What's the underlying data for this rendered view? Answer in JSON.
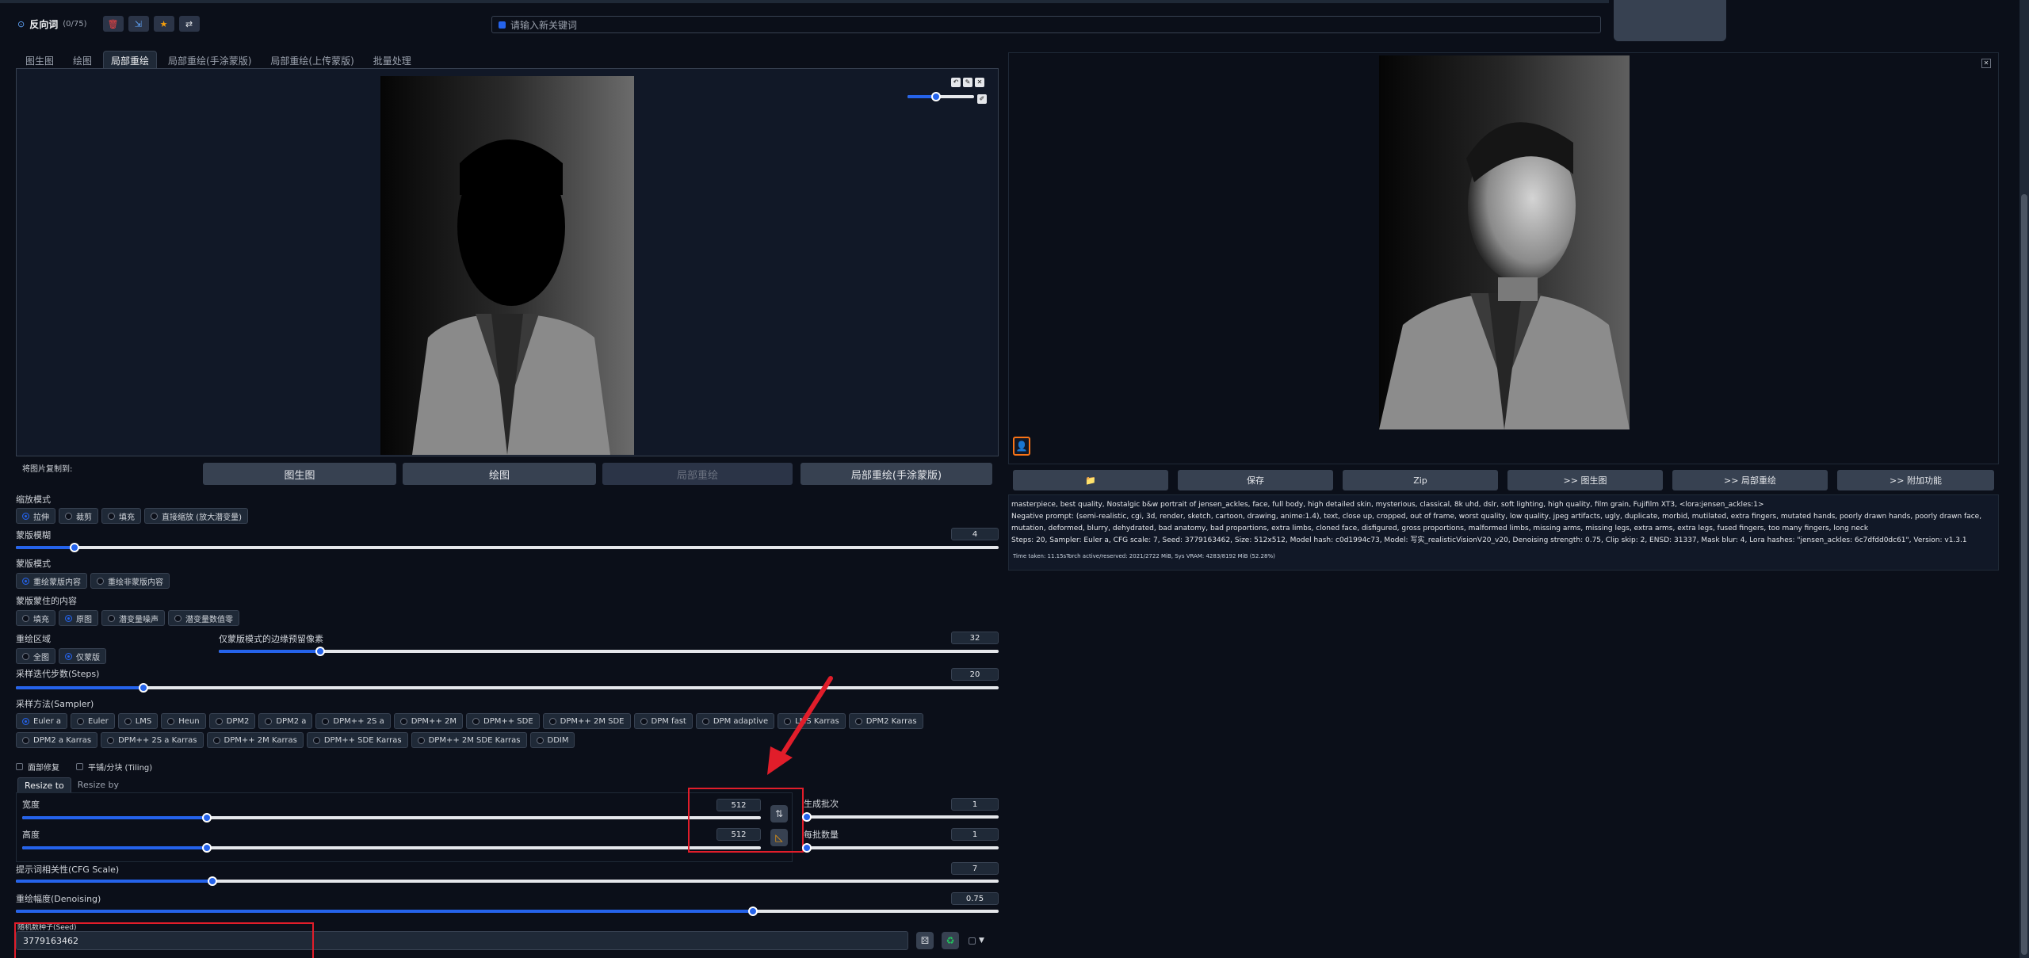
{
  "negative": {
    "title": "反向词",
    "count": "(0/75)",
    "placeholder": "请输入新关键词"
  },
  "tabs": [
    "图生图",
    "绘图",
    "局部重绘",
    "局部重绘(手涂蒙版)",
    "局部重绘(上传蒙版)",
    "批量处理"
  ],
  "canvas": {
    "copy_label": "将图片复制到:"
  },
  "copy_buttons": [
    "图生图",
    "绘图",
    "局部重绘",
    "局部重绘(手涂蒙版)"
  ],
  "resize_mode": {
    "label": "缩放模式",
    "options": [
      "拉伸",
      "裁剪",
      "填充",
      "直接缩放 (放大潜变量)"
    ]
  },
  "mask_blur": {
    "label": "蒙版模糊",
    "value": "4",
    "fraction": 0.06
  },
  "mask_mode": {
    "label": "蒙版模式",
    "options": [
      "重绘蒙版内容",
      "重绘非蒙版内容"
    ]
  },
  "masked_content": {
    "label": "蒙版蒙住的内容",
    "options": [
      "填充",
      "原图",
      "潜变量噪声",
      "潜变量数值零"
    ]
  },
  "inpaint_area": {
    "label": "重绘区域",
    "options": [
      "全图",
      "仅蒙版"
    ]
  },
  "padding": {
    "label": "仅蒙版模式的边缘预留像素",
    "value": "32",
    "fraction": 0.13
  },
  "steps": {
    "label": "采样迭代步数(Steps)",
    "value": "20",
    "fraction": 0.13
  },
  "sampler": {
    "label": "采样方法(Sampler)",
    "options": [
      "Euler a",
      "Euler",
      "LMS",
      "Heun",
      "DPM2",
      "DPM2 a",
      "DPM++ 2S a",
      "DPM++ 2M",
      "DPM++ SDE",
      "DPM++ 2M SDE",
      "DPM fast",
      "DPM adaptive",
      "LMS Karras",
      "DPM2 Karras",
      "DPM2 a Karras",
      "DPM++ 2S a Karras",
      "DPM++ 2M Karras",
      "DPM++ SDE Karras",
      "DPM++ 2M SDE Karras",
      "DDIM"
    ]
  },
  "checks": {
    "face_restore": "面部修复",
    "tiling": "平铺/分块 (Tiling)"
  },
  "resize_tabs": [
    "Resize to",
    "Resize by"
  ],
  "width": {
    "label": "宽度",
    "value": "512",
    "fraction": 0.25
  },
  "height": {
    "label": "高度",
    "value": "512",
    "fraction": 0.25
  },
  "batch_count": {
    "label": "生成批次",
    "value": "1",
    "fraction": 0.0
  },
  "batch_size": {
    "label": "每批数量",
    "value": "1",
    "fraction": 0.0
  },
  "cfg": {
    "label": "提示词相关性(CFG Scale)",
    "value": "7",
    "fraction": 0.2
  },
  "denoise": {
    "label": "重绘幅度(Denoising)",
    "value": "0.75",
    "fraction": 0.75
  },
  "seed": {
    "label": "随机数种子(Seed)",
    "value": "3779163462"
  },
  "output_buttons": [
    "📁",
    "保存",
    "Zip",
    ">> 图生图",
    ">> 局部重绘",
    ">> 附加功能"
  ],
  "info": {
    "prompt": "masterpiece, best quality, Nostalgic b&w portrait of jensen_ackles, face, full body, high detailed skin, mysterious, classical, 8k uhd, dslr, soft lighting, high quality, film grain, Fujifilm XT3, <lora:jensen_ackles:1>",
    "negative": "Negative prompt: (semi-realistic, cgi, 3d, render, sketch, cartoon, drawing, anime:1.4), text, close up, cropped, out of frame, worst quality, low quality, jpeg artifacts, ugly, duplicate, morbid, mutilated, extra fingers, mutated hands, poorly drawn hands, poorly drawn face, mutation, deformed, blurry, dehydrated, bad anatomy, bad proportions, extra limbs, cloned face, disfigured, gross proportions, malformed limbs, missing arms, missing legs, extra arms, extra legs, fused fingers, too many fingers, long neck",
    "params": "Steps: 20, Sampler: Euler a, CFG scale: 7, Seed: 3779163462, Size: 512x512, Model hash: c0d1994c73, Model: 写实_realisticVisionV20_v20, Denoising strength: 0.75, Clip skip: 2, ENSD: 31337, Mask blur: 4, Lora hashes: \"jensen_ackles: 6c7dfdd0dc61\", Version: v1.3.1",
    "timing": "Time taken: 11.15sTorch active/reserved: 2021/2722 MiB, Sys VRAM: 4283/8192 MiB (52.28%)"
  },
  "colors": {
    "accent": "#2563eb",
    "annotation": "#e11d2a",
    "background": "#0b0f19"
  }
}
